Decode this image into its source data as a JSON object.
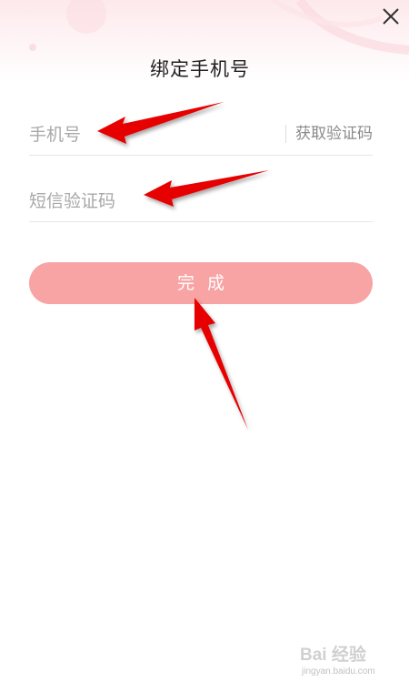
{
  "header": {
    "title": "绑定手机号",
    "close_icon": "close-icon"
  },
  "form": {
    "phone_placeholder": "手机号",
    "phone_value": "",
    "get_code_label": "获取验证码",
    "sms_placeholder": "短信验证码",
    "sms_value": "",
    "submit_label": "完成"
  },
  "colors": {
    "submit_bg": "#f8a3a4",
    "arrow": "#e60000",
    "placeholder": "#a8a8a8"
  },
  "watermark": {
    "brand": "Bai 经验",
    "url": "jingyan.baidu.com"
  }
}
